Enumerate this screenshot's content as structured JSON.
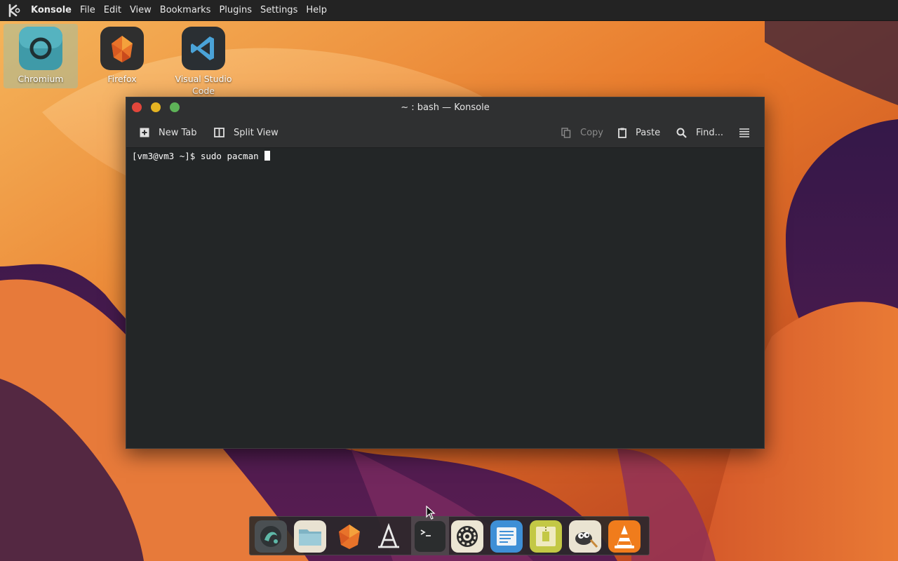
{
  "menubar": {
    "logo_icon": "kde-logo-icon",
    "app_name": "Konsole",
    "items": [
      "File",
      "Edit",
      "View",
      "Bookmarks",
      "Plugins",
      "Settings",
      "Help"
    ]
  },
  "desktop": {
    "icons": [
      {
        "label": "Chromium",
        "icon": "chromium-icon",
        "selected": true
      },
      {
        "label": "Firefox",
        "icon": "firefox-icon"
      },
      {
        "label": "Visual Studio Code",
        "icon": "vscode-icon"
      }
    ]
  },
  "window": {
    "title": "~ : bash — Konsole",
    "controls": [
      "close",
      "minimize",
      "maximize"
    ],
    "toolbar": {
      "new_tab": "New Tab",
      "split_view": "Split View",
      "copy": "Copy",
      "paste": "Paste",
      "find": "Find..."
    },
    "terminal": {
      "prompt": "[vm3@vm3 ~]$ ",
      "command": "sudo pacman "
    }
  },
  "dock": {
    "items": [
      "system-monitor-icon",
      "file-manager-icon",
      "firefox-icon",
      "app-store-icon",
      "terminal-icon",
      "settings-icon",
      "text-editor-icon",
      "archive-manager-icon",
      "gimp-icon",
      "vlc-icon"
    ],
    "active": "terminal-icon"
  },
  "colors": {
    "accent_close": "#e2463b",
    "accent_minimize": "#e5b422",
    "accent_maximize": "#5eb358",
    "terminal_bg": "#232627"
  }
}
